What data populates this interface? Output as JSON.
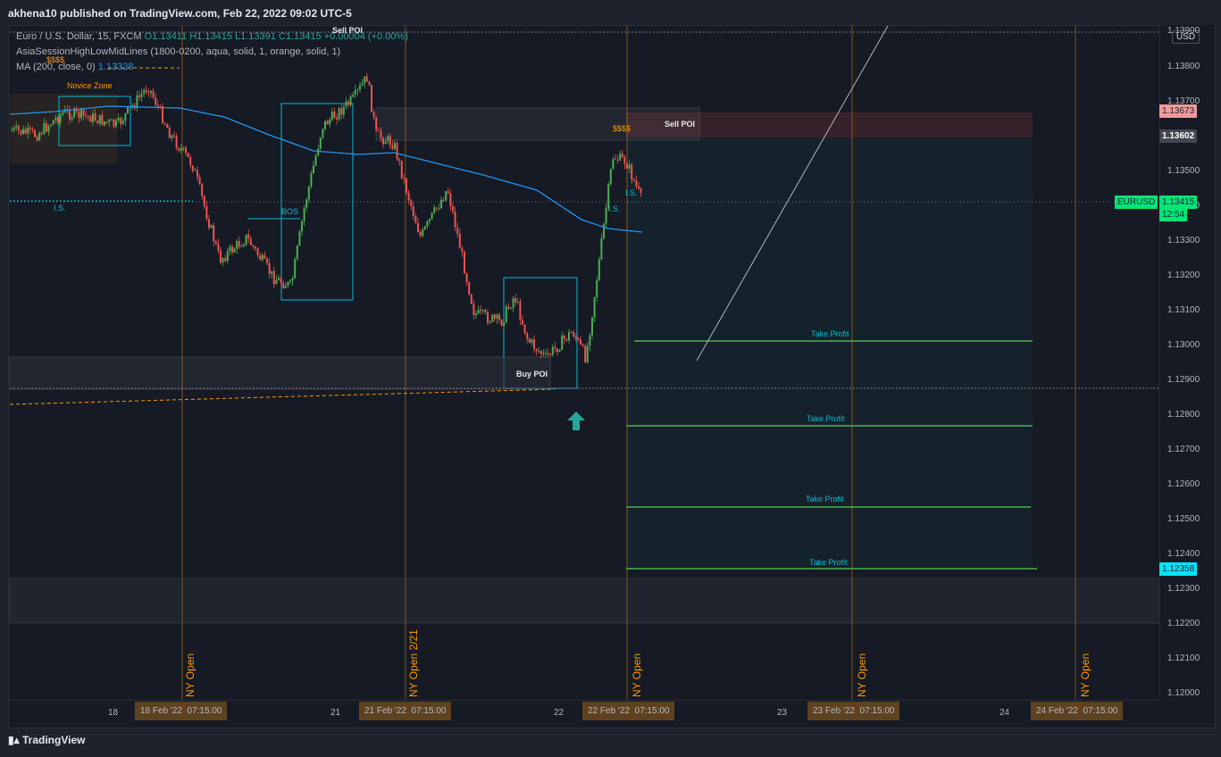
{
  "header": {
    "publisher_line": "akhena10 published on TradingView.com, Feb 22, 2022 09:02 UTC-5"
  },
  "legend": {
    "symbol_line": "Euro / U.S. Dollar, 15, FXCM",
    "ohlc": "O1.13411  H1.13415  L1.13391  C1.13415  +0.00004 (+0.00%)",
    "indicator_line": "AsiaSessionHighLowMidLines (1800-0200, aqua, solid, 1, orange, solid, 1)",
    "ma_line": "MA (200, close, 0)",
    "ma_value": "1.13328"
  },
  "price_axis": {
    "currency": "USD",
    "ticks": [
      "1.13900",
      "1.13800",
      "1.13700",
      "1.13500",
      "1.13400",
      "1.13300",
      "1.13200",
      "1.13100",
      "1.13000",
      "1.12900",
      "1.12800",
      "1.12700",
      "1.12600",
      "1.12500",
      "1.12400",
      "1.12300",
      "1.12200",
      "1.12100",
      "1.12000"
    ],
    "sell_poi_high": "1.13673",
    "sell_poi_low": "1.13602",
    "symbol": "EURUSD",
    "current_price": "1.13415",
    "countdown": "12:54",
    "target_price": "1.12358"
  },
  "time_axis": {
    "labels": [
      "18",
      "21",
      "22",
      "23",
      "24"
    ],
    "date_boxes": [
      "18 Feb '22",
      "21 Feb '22",
      "22 Feb '22",
      "23 Feb '22",
      "24 Feb '22"
    ],
    "times": [
      "07:15:00",
      "07:15:00",
      "07:15:00",
      "07:15:00",
      "07:15:00"
    ]
  },
  "annotations": {
    "novice_zone": "Novice Zone",
    "sell_poi_top": "Sell POI",
    "sell_poi": "Sell POI",
    "buy_poi": "Buy POI",
    "bos": "BOS",
    "is_left": "I.S.",
    "is_right": "I.S.",
    "ss_right": "I.S.",
    "dollars_left": "$$$$",
    "dollars_right": "$$$$",
    "take_profit": [
      "Take Profit",
      "Take Profit",
      "Take Profit",
      "Take Profit"
    ],
    "ny_open": [
      "NY Open",
      "NY Open 2/21",
      "NY Open",
      "NY Open",
      "NY Open"
    ]
  },
  "colors": {
    "bull": "#4caf50",
    "bear": "#ef5350",
    "ma": "#2196f3",
    "session": "#ff9800",
    "aqua": "#00bcd4",
    "tp": "#4caf50",
    "price_tag": "#00e676",
    "target_tag": "#00e5ff",
    "sell_tag": "#ef9a9a"
  },
  "footer": {
    "brand": "TradingView"
  }
}
